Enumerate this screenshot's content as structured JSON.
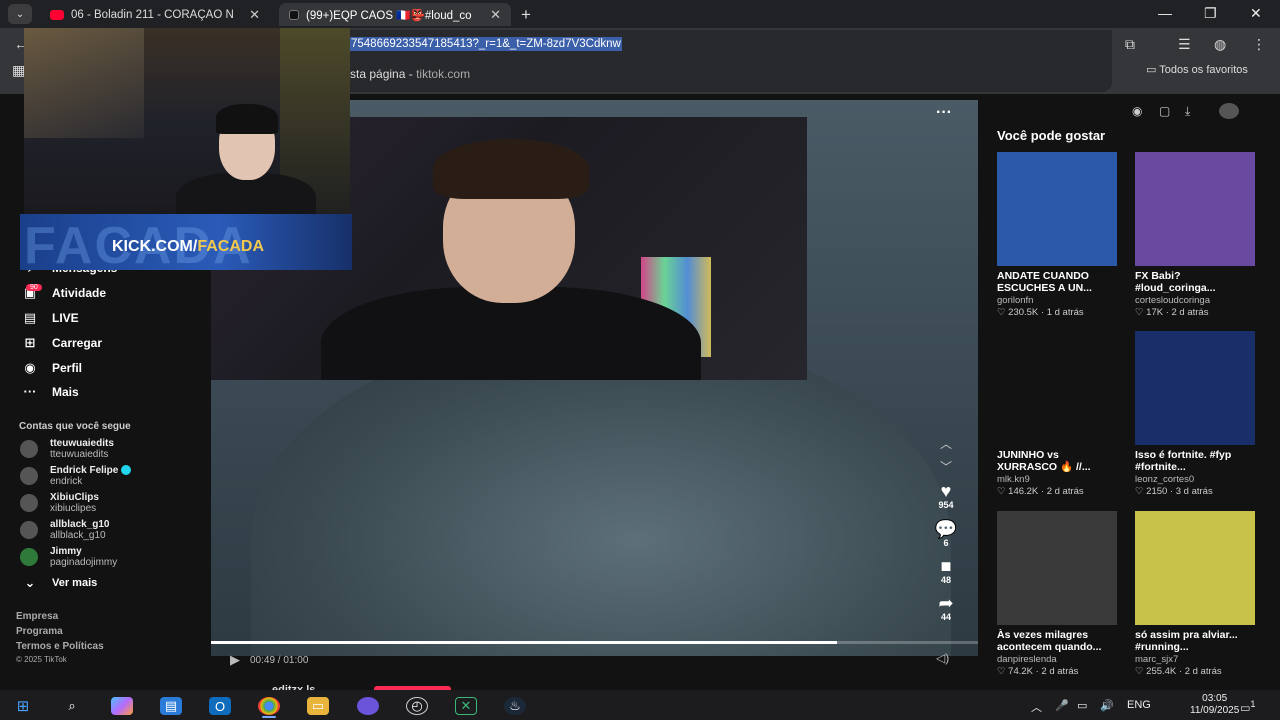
{
  "browser": {
    "tabs": [
      {
        "title": "06 - Boladin 211 - CORAÇÃO N",
        "color": "#ff0033"
      },
      {
        "title": "(99+)EQP CAOS 🇫🇷👺#loud_co",
        "color": "#111111"
      }
    ],
    "url_selected": "7548669233547185413?_r=1&_t=ZM-8zd7V3Cdknw",
    "suggestion_text": "sta página",
    "suggestion_domain": "tiktok.com",
    "bookmarks_label": "Todos os favoritos"
  },
  "overlay": {
    "brand_big": "FACADA",
    "kick_prefix": "KICK.COM/",
    "kick_name": "FACADA"
  },
  "sidebar": {
    "activity_badge": "90",
    "items": [
      {
        "label": "Mensagens",
        "icon": "paper-plane"
      },
      {
        "label": "Atividade",
        "icon": "inbox"
      },
      {
        "label": "LIVE",
        "icon": "live-tv"
      },
      {
        "label": "Carregar",
        "icon": "plus-square"
      },
      {
        "label": "Perfil",
        "icon": "avatar"
      },
      {
        "label": "Mais",
        "icon": "ellipsis"
      }
    ],
    "following_title": "Contas que você segue",
    "accounts": [
      {
        "name": "tteuwuaiedits",
        "handle": "tteuwuaiedits",
        "verified": false
      },
      {
        "name": "Endrick Felipe",
        "handle": "endrick",
        "verified": true
      },
      {
        "name": "XibiuClips",
        "handle": "xibiuclipes",
        "verified": false
      },
      {
        "name": "allblack_g10",
        "handle": "allblack_g10",
        "verified": false
      },
      {
        "name": "Jimmy",
        "handle": "paginadojimmy",
        "verified": false
      }
    ],
    "see_more": "Ver mais",
    "footer": [
      "Empresa",
      "Programa",
      "Termos e Políticas",
      "© 2025 TikTok"
    ]
  },
  "video": {
    "time": "00:49 / 01:00",
    "progress": 0.8167,
    "likes": "954",
    "comments": "6",
    "saves": "48",
    "shares": "44",
    "next_user": "editzx.ls"
  },
  "recommend": {
    "title": "Você pode gostar",
    "cards": [
      {
        "caption": "ANDATE CUANDO ESCUCHES A UN...",
        "author": "gorilonfn",
        "meta": "♡ 230.5K · 1 d atrás",
        "color": "#2d5aa8"
      },
      {
        "caption": "FX Babi? #loud_coringa...",
        "author": "cortesloudcoringa",
        "meta": "♡ 17K · 2 d atrás",
        "color": "#6a4aa0"
      },
      {
        "caption": "JUNINHO vs XURRASCO 🔥 //...",
        "author": "mlk.kn9",
        "meta": "♡ 146.2K · 2 d atrás",
        "color": "#121212"
      },
      {
        "caption": "Isso é fortnite. #fyp #fortnite...",
        "author": "leonz_cortes0",
        "meta": "♡ 2150 · 3 d atrás",
        "color": "#1a2f6a"
      },
      {
        "caption": "Às vezes milagres acontecem quando...",
        "author": "danpireslenda",
        "meta": "♡ 74.2K · 2 d atrás",
        "color": "#3a3a3a"
      },
      {
        "caption": "só assim pra alviar... #running...",
        "author": "marc_sjx7",
        "meta": "♡ 255.4K · 2 d atrás",
        "color": "#c9c24a"
      }
    ]
  },
  "taskbar": {
    "lang": "ENG",
    "time": "03:05",
    "date": "11/09/2025",
    "notifications": "1"
  }
}
